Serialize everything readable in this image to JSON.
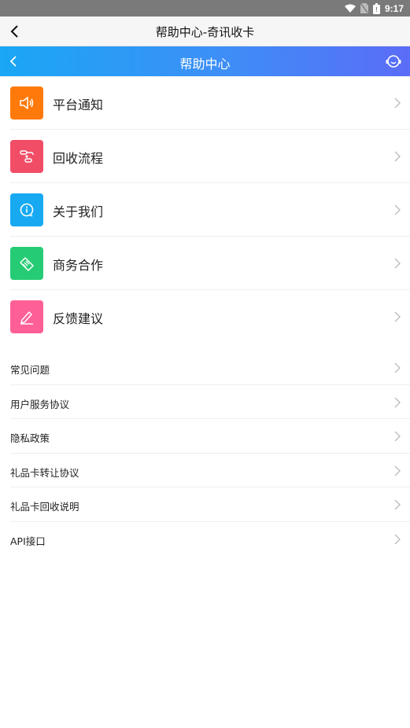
{
  "status_bar": {
    "time": "9:17"
  },
  "app_bar": {
    "title": "帮助中心-奇讯收卡"
  },
  "header": {
    "title": "帮助中心"
  },
  "menu": [
    {
      "label": "平台通知",
      "icon": "speaker-icon",
      "color": "#ff7a0a"
    },
    {
      "label": "回收流程",
      "icon": "flow-icon",
      "color": "#f24d67"
    },
    {
      "label": "关于我们",
      "icon": "info-chat-icon",
      "color": "#17aaf2"
    },
    {
      "label": "商务合作",
      "icon": "handshake-icon",
      "color": "#26cc75"
    },
    {
      "label": "反馈建议",
      "icon": "pen-icon",
      "color": "#ff5f97"
    }
  ],
  "links": [
    {
      "label": "常见问题"
    },
    {
      "label": "用户服务协议"
    },
    {
      "label": "隐私政策"
    },
    {
      "label": "礼品卡转让协议"
    },
    {
      "label": "礼品卡回收说明"
    },
    {
      "label": "API接口"
    }
  ]
}
